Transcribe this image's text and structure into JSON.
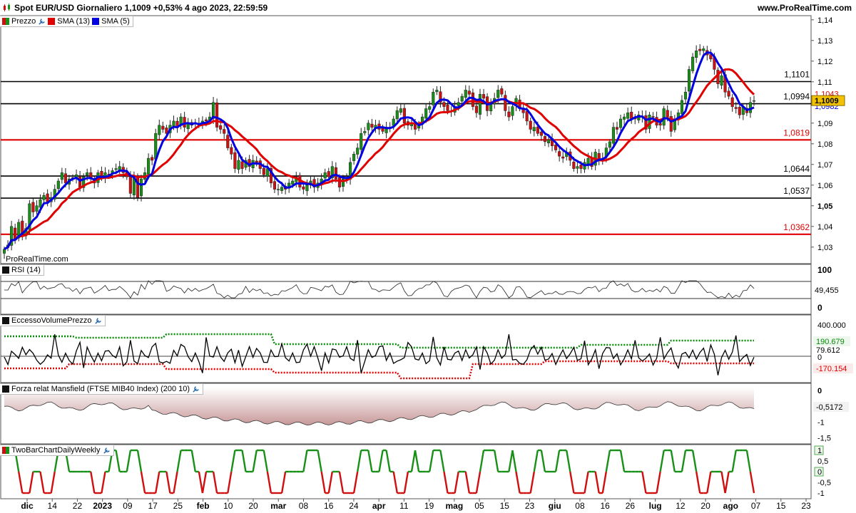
{
  "header": {
    "title": "Spot EUR/USD Giornaliero 1,1009 +0,53% 4 ago 2023, 22:59:59",
    "site": "www.ProRealTime.com"
  },
  "watermark": "ProRealTime.com",
  "colors": {
    "up": "#189018",
    "down": "#d01010",
    "sma13": "#e00000",
    "sma5": "#0000e0",
    "hline_black": "#000000",
    "hline_red": "#e00000",
    "current_price_bg": "#f2c200",
    "mansfield_fill": "#c89898"
  },
  "panels": {
    "price": {
      "legend": [
        {
          "label": "Prezzo",
          "icon": "price-swatch"
        },
        {
          "label": "SMA (13)",
          "icon": "red-swatch"
        },
        {
          "label": "SMA (5)",
          "icon": "blue-swatch"
        }
      ]
    },
    "rsi": {
      "legend": "RSI (14)"
    },
    "evp": {
      "legend": "EccessoVolumePrezzo"
    },
    "mansfield": {
      "legend": "Forza relat Mansfield (FTSE MIB40 Index) (200 10)"
    },
    "twobar": {
      "legend": "TwoBarChartDailyWeekly"
    }
  },
  "chart_data": [
    {
      "type": "candlestick",
      "title": "Spot EUR/USD Giornaliero",
      "y_ticks": [
        "1,03",
        "1,04",
        "1,05",
        "1,06",
        "1,07",
        "1,08",
        "1,09",
        "1,1",
        "1,11",
        "1,12",
        "1,13",
        "1,14"
      ],
      "ylim": [
        1.022,
        1.142
      ],
      "x_tick_labels": [
        "dic",
        "14",
        "22",
        "2023",
        "09",
        "17",
        "25",
        "feb",
        "10",
        "20",
        "mar",
        "08",
        "16",
        "24",
        "apr",
        "11",
        "19",
        "mag",
        "05",
        "15",
        "23",
        "giu",
        "08",
        "16",
        "26",
        "lug",
        "12",
        "20",
        "ago",
        "07",
        "15",
        "23"
      ],
      "horizontal_levels": [
        {
          "value": 1.1101,
          "label": "1,1101",
          "color": "black"
        },
        {
          "value": 1.0994,
          "label": "1,0994",
          "color": "black"
        },
        {
          "value": 1.0819,
          "label": "1,0819",
          "color": "red"
        },
        {
          "value": 1.0644,
          "label": "1,0644",
          "color": "black"
        },
        {
          "value": 1.0537,
          "label": "1,0537",
          "color": "black"
        },
        {
          "value": 1.0362,
          "label": "1,0362",
          "color": "red"
        }
      ],
      "last_values": {
        "price": "1,1009",
        "sma13": "1,1043",
        "sma5": "1,0982"
      },
      "closes": [
        1.029,
        1.031,
        1.04,
        1.034,
        1.042,
        1.036,
        1.039,
        1.051,
        1.047,
        1.05,
        1.053,
        1.055,
        1.052,
        1.054,
        1.058,
        1.062,
        1.066,
        1.061,
        1.063,
        1.063,
        1.065,
        1.059,
        1.064,
        1.066,
        1.063,
        1.061,
        1.066,
        1.064,
        1.066,
        1.065,
        1.067,
        1.068,
        1.069,
        1.066,
        1.064,
        1.056,
        1.064,
        1.054,
        1.063,
        1.066,
        1.073,
        1.072,
        1.085,
        1.089,
        1.087,
        1.085,
        1.089,
        1.091,
        1.088,
        1.093,
        1.088,
        1.09,
        1.089,
        1.09,
        1.09,
        1.091,
        1.091,
        1.093,
        1.1,
        1.088,
        1.087,
        1.085,
        1.078,
        1.075,
        1.068,
        1.072,
        1.068,
        1.072,
        1.069,
        1.072,
        1.071,
        1.068,
        1.065,
        1.068,
        1.061,
        1.058,
        1.058,
        1.059,
        1.058,
        1.061,
        1.062,
        1.064,
        1.059,
        1.058,
        1.06,
        1.062,
        1.059,
        1.061,
        1.063,
        1.066,
        1.064,
        1.069,
        1.063,
        1.059,
        1.063,
        1.063,
        1.071,
        1.075,
        1.078,
        1.085,
        1.086,
        1.09,
        1.088,
        1.089,
        1.087,
        1.086,
        1.088,
        1.088,
        1.092,
        1.096,
        1.097,
        1.09,
        1.089,
        1.09,
        1.087,
        1.089,
        1.093,
        1.097,
        1.098,
        1.105,
        1.106,
        1.1,
        1.098,
        1.096,
        1.096,
        1.098,
        1.1,
        1.103,
        1.106,
        1.104,
        1.098,
        1.095,
        1.104,
        1.102,
        1.096,
        1.1,
        1.102,
        1.106,
        1.104,
        1.096,
        1.093,
        1.098,
        1.102,
        1.097,
        1.095,
        1.091,
        1.087,
        1.088,
        1.085,
        1.084,
        1.081,
        1.082,
        1.079,
        1.077,
        1.074,
        1.073,
        1.076,
        1.072,
        1.068,
        1.069,
        1.068,
        1.071,
        1.073,
        1.069,
        1.076,
        1.072,
        1.073,
        1.078,
        1.081,
        1.088,
        1.087,
        1.092,
        1.093,
        1.095,
        1.092,
        1.092,
        1.094,
        1.093,
        1.087,
        1.094,
        1.093,
        1.089,
        1.089,
        1.097,
        1.093,
        1.086,
        1.092,
        1.095,
        1.101,
        1.105,
        1.116,
        1.122,
        1.125,
        1.125,
        1.126,
        1.123,
        1.121,
        1.116,
        1.109,
        1.113,
        1.105,
        1.103,
        1.098,
        1.097,
        1.094,
        1.098,
        1.095,
        1.1,
        1.1009
      ]
    },
    {
      "type": "line",
      "title": "RSI (14)",
      "y_ticks": [
        "100",
        "0"
      ],
      "ylim": [
        0,
        100
      ],
      "last_value": "49,455"
    },
    {
      "type": "line",
      "title": "EccessoVolumePrezzo",
      "y_ticks": [
        "400.000",
        "0"
      ],
      "last_values": {
        "upper": "190.679",
        "value": "79.612",
        "lower": "-170.154"
      }
    },
    {
      "type": "area",
      "title": "Forza relat Mansfield (FTSE MIB40 Index) (200 10)",
      "y_ticks": [
        "0",
        "-0,5",
        "-1",
        "-1,5"
      ],
      "ylim": [
        -1.65,
        0.1
      ],
      "last_value": "-0,5172"
    },
    {
      "type": "line",
      "title": "TwoBarChartDailyWeekly",
      "y_ticks": [
        "1",
        "0,5",
        "0",
        "-0,5",
        "-1"
      ],
      "ylim": [
        -1.2,
        1.2
      ],
      "highlighted": [
        "1",
        "0"
      ]
    }
  ]
}
